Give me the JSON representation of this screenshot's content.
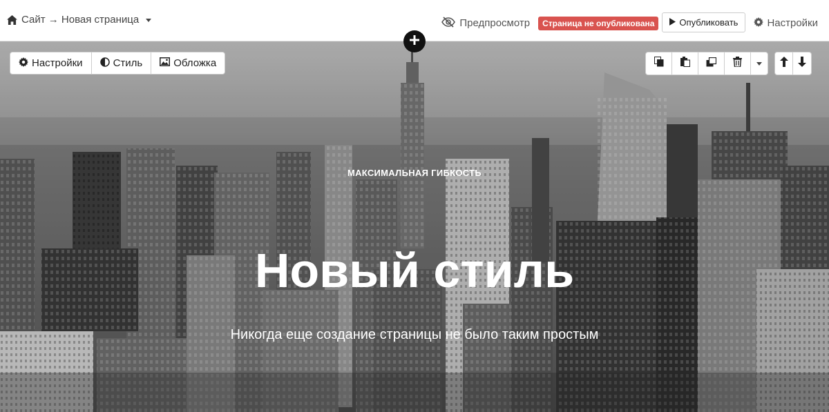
{
  "topbar": {
    "breadcrumb": "Сайт → Новая страница",
    "preview_label": "Предпросмотр",
    "status_badge": "Страница не опубликована",
    "publish_label": "Опубликовать",
    "settings_label": "Настройки"
  },
  "block_toolbar": {
    "settings_label": "Настройки",
    "style_label": "Стиль",
    "cover_label": "Обложка"
  },
  "block_actions": [
    "copy-icon",
    "paste-icon",
    "duplicate-icon",
    "trash-icon",
    "chevron-down-icon"
  ],
  "move_actions": [
    "arrow-up-icon",
    "arrow-down-icon"
  ],
  "hero": {
    "eyebrow": "МАКСИМАЛЬНАЯ ГИБКОСТЬ",
    "title": "Новый стиль",
    "subtitle": "Никогда еще создание страницы не было таким простым"
  },
  "colors": {
    "badge": "#d9534f",
    "hero_text": "#ffffff",
    "add_button": "#111111"
  }
}
